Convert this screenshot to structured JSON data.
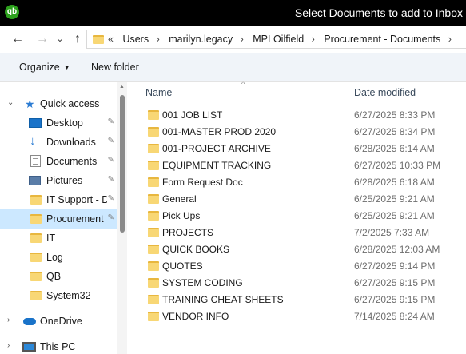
{
  "titlebar": {
    "logo": "qb",
    "title": "Select Documents to add to Inbox"
  },
  "nav": {
    "back_icon": "←",
    "forward_icon": "→",
    "up_icon": "↑",
    "chevron_icon": "⌄"
  },
  "address": {
    "overflow": "«",
    "crumbs": [
      "Users",
      "marilyn.legacy",
      "MPI Oilfield",
      "Procurement - Documents"
    ],
    "sep": "›"
  },
  "toolbar": {
    "organize": "Organize",
    "new_folder": "New folder"
  },
  "sidebar": {
    "items": [
      {
        "label": "Quick access",
        "icon": "star-icon",
        "chevron": "⌄",
        "pinned": false
      },
      {
        "label": "Desktop",
        "icon": "desktop-icon",
        "pinned": true
      },
      {
        "label": "Downloads",
        "icon": "download-icon",
        "pinned": true
      },
      {
        "label": "Documents",
        "icon": "documents-icon",
        "pinned": true
      },
      {
        "label": "Pictures",
        "icon": "pictures-icon",
        "pinned": true
      },
      {
        "label": "IT Support - D",
        "icon": "folder-icon",
        "pinned": true
      },
      {
        "label": "Procurement",
        "icon": "folder-icon",
        "pinned": true,
        "selected": true
      },
      {
        "label": "IT",
        "icon": "folder-icon",
        "pinned": false
      },
      {
        "label": "Log",
        "icon": "folder-icon",
        "pinned": false
      },
      {
        "label": "QB",
        "icon": "folder-icon",
        "pinned": false
      },
      {
        "label": "System32",
        "icon": "folder-icon",
        "pinned": false
      },
      {
        "label": "OneDrive",
        "icon": "cloud-icon",
        "chevron": "›"
      },
      {
        "label": "This PC",
        "icon": "computer-icon",
        "chevron": "›"
      }
    ],
    "pin_glyph": "📌"
  },
  "columns": {
    "name": "Name",
    "date": "Date modified",
    "sort_glyph": "^"
  },
  "files": [
    {
      "name": "001 JOB LIST",
      "date": "6/27/2025 8:33 PM"
    },
    {
      "name": "001-MASTER PROD 2020",
      "date": "6/27/2025 8:34 PM"
    },
    {
      "name": "001-PROJECT ARCHIVE",
      "date": "6/28/2025 6:14 AM"
    },
    {
      "name": "EQUIPMENT TRACKING",
      "date": "6/27/2025 10:33 PM"
    },
    {
      "name": "Form Request Doc",
      "date": "6/28/2025 6:18 AM"
    },
    {
      "name": "General",
      "date": "6/25/2025 9:21 AM"
    },
    {
      "name": "Pick Ups",
      "date": "6/25/2025 9:21 AM"
    },
    {
      "name": "PROJECTS",
      "date": "7/2/2025 7:33 AM"
    },
    {
      "name": "QUICK BOOKS",
      "date": "6/28/2025 12:03 AM"
    },
    {
      "name": "QUOTES",
      "date": "6/27/2025 9:14 PM"
    },
    {
      "name": "SYSTEM CODING",
      "date": "6/27/2025 9:15 PM"
    },
    {
      "name": "TRAINING CHEAT SHEETS",
      "date": "6/27/2025 9:15 PM"
    },
    {
      "name": "VENDOR INFO",
      "date": "7/14/2025 8:24 AM"
    }
  ],
  "colors": {
    "selected": "#cce8ff",
    "folder": "#f8d775",
    "titlebar": "#000000",
    "toolbar": "#f0f4f9"
  }
}
